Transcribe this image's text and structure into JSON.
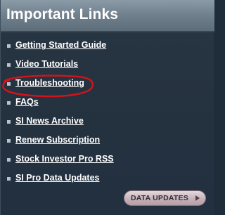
{
  "header": {
    "title": "Important Links"
  },
  "links": [
    {
      "label": "Getting Started Guide"
    },
    {
      "label": "Video Tutorials"
    },
    {
      "label": "Troubleshooting"
    },
    {
      "label": "FAQs"
    },
    {
      "label": "SI News Archive"
    },
    {
      "label": "Renew Subscription"
    },
    {
      "label": "Stock Investor Pro RSS"
    },
    {
      "label": "SI Pro Data Updates"
    }
  ],
  "button": {
    "label": "DATA UPDATES",
    "icon": "right-arrow-icon"
  },
  "colors": {
    "panel_bg": "#25323f",
    "header_bg": "#6f7f8c",
    "link_text": "#ffffff",
    "annotation": "#d0141b"
  }
}
